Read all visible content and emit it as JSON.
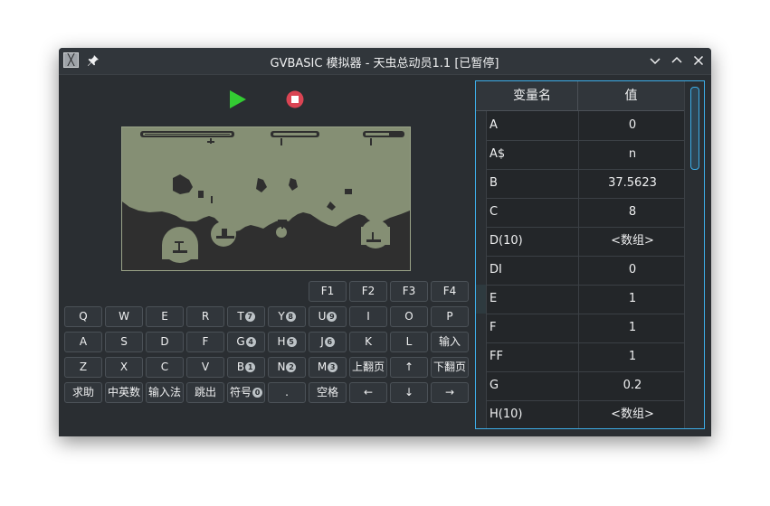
{
  "window": {
    "title": "GVBASIC 模拟器 - 天虫总动员1.1 [已暂停]",
    "app_icon_glyph": "╳"
  },
  "colors": {
    "accent": "#3daee9",
    "play": "#33cc33",
    "stop": "#da4453",
    "lcd_bg": "#858f74",
    "lcd_fg": "#2f2f2f"
  },
  "keyboard": {
    "row0": [
      "F1",
      "F2",
      "F3",
      "F4"
    ],
    "row1": [
      {
        "label": "Q"
      },
      {
        "label": "W"
      },
      {
        "label": "E"
      },
      {
        "label": "R"
      },
      {
        "label": "T",
        "badge": "7"
      },
      {
        "label": "Y",
        "badge": "8"
      },
      {
        "label": "U",
        "badge": "9"
      },
      {
        "label": "I"
      },
      {
        "label": "O"
      },
      {
        "label": "P"
      }
    ],
    "row2": [
      {
        "label": "A"
      },
      {
        "label": "S"
      },
      {
        "label": "D"
      },
      {
        "label": "F"
      },
      {
        "label": "G",
        "badge": "4"
      },
      {
        "label": "H",
        "badge": "5"
      },
      {
        "label": "J",
        "badge": "6"
      },
      {
        "label": "K"
      },
      {
        "label": "L"
      },
      {
        "label": "输入"
      }
    ],
    "row3": [
      {
        "label": "Z"
      },
      {
        "label": "X"
      },
      {
        "label": "C"
      },
      {
        "label": "V"
      },
      {
        "label": "B",
        "badge": "1"
      },
      {
        "label": "N",
        "badge": "2"
      },
      {
        "label": "M",
        "badge": "3"
      },
      {
        "label": "上翻页"
      },
      {
        "label": "↑"
      },
      {
        "label": "下翻页"
      }
    ],
    "row4": [
      {
        "label": "求助"
      },
      {
        "label": "中英数"
      },
      {
        "label": "输入法"
      },
      {
        "label": "跳出"
      },
      {
        "label": "符号",
        "badge": "0"
      },
      {
        "label": "."
      },
      {
        "label": "空格"
      },
      {
        "label": "←"
      },
      {
        "label": "↓"
      },
      {
        "label": "→"
      }
    ]
  },
  "variables": {
    "header_name": "变量名",
    "header_value": "值",
    "rows": [
      {
        "name": "A",
        "value": "0"
      },
      {
        "name": "A$",
        "value": "n"
      },
      {
        "name": "B",
        "value": "37.5623"
      },
      {
        "name": "C",
        "value": "8"
      },
      {
        "name": "D(10)",
        "value": "<数组>"
      },
      {
        "name": "DI",
        "value": "0"
      },
      {
        "name": "E",
        "value": "1"
      },
      {
        "name": "F",
        "value": "1"
      },
      {
        "name": "FF",
        "value": "1"
      },
      {
        "name": "G",
        "value": "0.2"
      },
      {
        "name": "H(10)",
        "value": "<数组>"
      }
    ]
  }
}
